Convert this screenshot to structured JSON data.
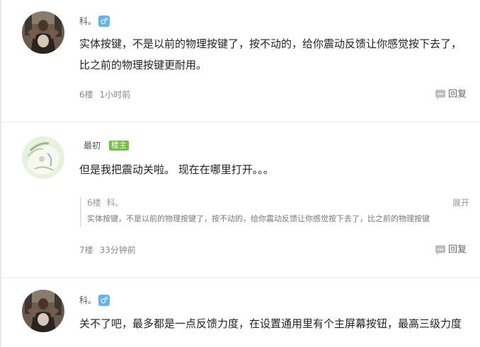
{
  "comments": [
    {
      "username": "科。",
      "gender": "♂",
      "content": "实体按键，不是以前的物理按键了，按不动的，给你震动反馈让你感觉按下去了，比之前的物理按键更耐用。",
      "floor": "6楼",
      "time": "1小时前",
      "reply_label": "回复"
    },
    {
      "username": "最初",
      "badge": "楼主",
      "content": "但是我把震动关啦。 现在在哪里打开。。。",
      "quote": {
        "floor": "6楼",
        "username": "科。",
        "expand": "展开",
        "text": "实体按键，不是以前的物理按键了，按不动的，给你震动反馈让你感觉按下去了，比之前的物理按键"
      },
      "floor": "7楼",
      "time": "33分钟前",
      "reply_label": "回复"
    },
    {
      "username": "科。",
      "gender": "♂",
      "content": "关不了吧，最多都是一点反馈力度，在设置通用里有个主屏幕按钮，最高三级力度"
    }
  ],
  "colors": {
    "gender_badge": "#63b3f0",
    "owner_badge": "#72c042",
    "separator": "#ececec"
  }
}
